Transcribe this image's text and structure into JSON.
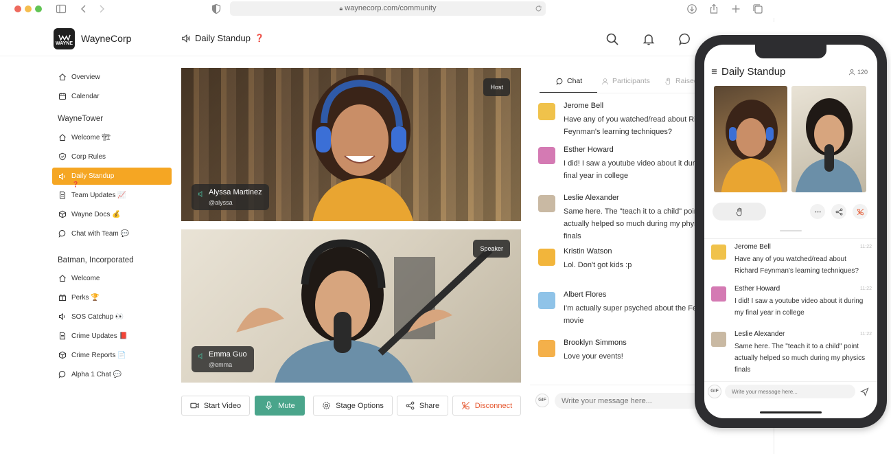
{
  "browser": {
    "url": "waynecorp.com/community"
  },
  "header": {
    "brand_logo_text": "WAYNE",
    "brand": "WayneCorp",
    "room_title": "Daily Standup",
    "room_emoji": "❓"
  },
  "sidebar": {
    "top_items": [
      {
        "label": "Overview",
        "icon": "home-icon"
      },
      {
        "label": "Calendar",
        "icon": "calendar-icon"
      }
    ],
    "groups": [
      {
        "title": "WayneTower",
        "items": [
          {
            "label": "Welcome 🏗",
            "icon": "home-icon"
          },
          {
            "label": "Corp Rules",
            "icon": "shield-icon"
          },
          {
            "label": "Daily Standup",
            "icon": "speaker-icon",
            "active": true
          },
          {
            "label": "Team Updates 📈",
            "icon": "document-icon"
          },
          {
            "label": "Wayne Docs 💰",
            "icon": "box-icon"
          },
          {
            "label": "Chat with Team 💬",
            "icon": "chat-icon"
          }
        ]
      },
      {
        "title": "Batman, Incorporated",
        "items": [
          {
            "label": "Welcome",
            "icon": "home-icon"
          },
          {
            "label": "Perks 🏆",
            "icon": "gift-icon"
          },
          {
            "label": "SOS Catchup 👀",
            "icon": "speaker-icon"
          },
          {
            "label": "Crime Updates 📕",
            "icon": "document-icon"
          },
          {
            "label": "Crime Reports 📄",
            "icon": "box-icon"
          },
          {
            "label": "Alpha 1 Chat 💬",
            "icon": "chat-icon"
          }
        ]
      }
    ],
    "active_extra": "❓"
  },
  "video": {
    "tiles": [
      {
        "name": "Alyssa Martinez",
        "handle": "@alyssa",
        "role": "Host"
      },
      {
        "name": "Emma Guo",
        "handle": "@emma",
        "role": "Speaker"
      }
    ]
  },
  "controls": {
    "start_video": "Start Video",
    "mute": "Mute",
    "stage_options": "Stage Options",
    "share": "Share",
    "disconnect": "Disconnect"
  },
  "chat": {
    "tabs": [
      "Chat",
      "Participants",
      "Raised"
    ],
    "messages": [
      {
        "name": "Jerome Bell",
        "text": "Have any of you watched/read about Richard Feynman's learning techniques?",
        "avatar_color": "#f0c24b"
      },
      {
        "name": "Esther Howard",
        "text": "I did! I saw a youtube video about it during my final year in college",
        "avatar_color": "#d47ab3"
      },
      {
        "name": "Leslie Alexander",
        "text": "Same here. The \"teach it to a child\" point actually helped so much during my physics finals",
        "avatar_color": "#c9b9a3"
      },
      {
        "name": "Kristin Watson",
        "text": "Lol. Don't got kids :p",
        "avatar_color": "#f2b53b"
      },
      {
        "name": "Albert Flores",
        "text": "I'm actually super psyched about the Feynman movie",
        "avatar_color": "#8fc3e8"
      },
      {
        "name": "Brooklyn Simmons",
        "text": "Love your events!",
        "avatar_color": "#f4b04a"
      }
    ],
    "gif": "GIF",
    "placeholder": "Write your message here..."
  },
  "phone": {
    "title": "Daily Standup",
    "participants": "120",
    "messages": [
      {
        "name": "Jerome Bell",
        "time": "11:22",
        "text": "Have any of you watched/read about Richard Feynman's learning techniques?",
        "avatar_color": "#f0c24b"
      },
      {
        "name": "Esther Howard",
        "time": "11:22",
        "text": "I did! I saw a youtube video about it during my final year in college",
        "avatar_color": "#d47ab3"
      },
      {
        "name": "Leslie Alexander",
        "time": "11:22",
        "text": "Same here. The \"teach it to a child\" point actually helped so much during my physics finals",
        "avatar_color": "#c9b9a3"
      }
    ],
    "gif": "GIF",
    "placeholder": "Write your message here..."
  },
  "colors": {
    "accent": "#f5a623",
    "mute_button": "#4aa58b",
    "disconnect": "#e5572f"
  }
}
